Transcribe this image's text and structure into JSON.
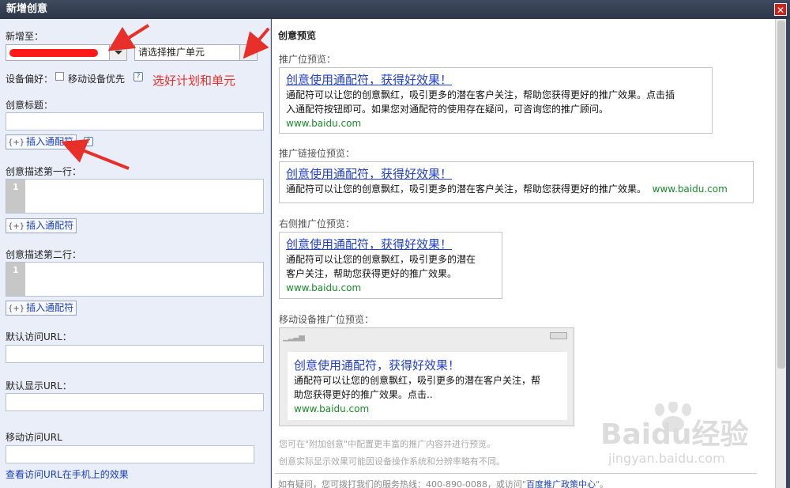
{
  "window": {
    "title": "新增创意",
    "close": "✕"
  },
  "form": {
    "add_to_label": "新增至：",
    "unit_select": "请选择推广单元",
    "device_pref_label": "设备偏好：",
    "mobile_first_label": "移动设备优先",
    "help_glyph": "?",
    "annotation": "选好计划和单元",
    "title_label": "创意标题：",
    "insert_wildcard": "插入通配符",
    "wildcard_glyph": "{+}",
    "desc1_label": "创意描述第一行：",
    "desc2_label": "创意描述第二行：",
    "line_number": "1",
    "default_url_label": "默认访问URL：",
    "display_url_label": "默认显示URL：",
    "mobile_url_label": "移动访问URL",
    "mobile_effect_link": "查看访问URL在手机上的效果"
  },
  "preview": {
    "title": "创意预览",
    "placement_label": "推广位预览：",
    "link_label": "推广链接位预览：",
    "right_label": "右侧推广位预览：",
    "mobile_label": "移动设备推广位预览：",
    "ad_title": "创意使用通配符，获得好效果！",
    "ad_desc_1a": "通配符可以让您的创意飘红，吸引更多的潜在客户关注，帮助您获得更好的推广效果。点击插",
    "ad_desc_1b": "入通配符按钮即可。如果您对通配符的使用存在疑问，可咨询您的推广顾问。",
    "ad_desc_link": "通配符可以让您的创意飘红，吸引更多的潜在客户关注，帮助您获得更好的推广效果。",
    "ad_desc_right_a": "通配符可以让您的创意飘红，吸引更多的潜在",
    "ad_desc_right_b": "客户关注，帮助您获得更好的推广效果。",
    "ad_desc_mobile_a": "通配符可以让您的创意飘红，吸引更多的潜在客户关注，帮",
    "ad_desc_mobile_b": "助您获得更好的推广效果。点击..",
    "ad_url": "www.baidu.com",
    "note_1": "您可在\"附加创意\"中配置更丰富的推广内容并进行预览。",
    "note_2": "创意实际显示效果可能因设备操作系统和分辨率略有不同。",
    "footer_text": "如有疑问，您可拨打我们的服务热线：400-890-0088，或访问\"",
    "footer_link": "百度推广政策中心",
    "footer_end": "\"。"
  },
  "watermark": {
    "main": "Baidu经验",
    "sub": "jingyan.baidu.com"
  },
  "colors": {
    "annotation_red": "#e8302a",
    "ad_link_blue": "#2340c8",
    "url_green": "#1a8a2a"
  }
}
